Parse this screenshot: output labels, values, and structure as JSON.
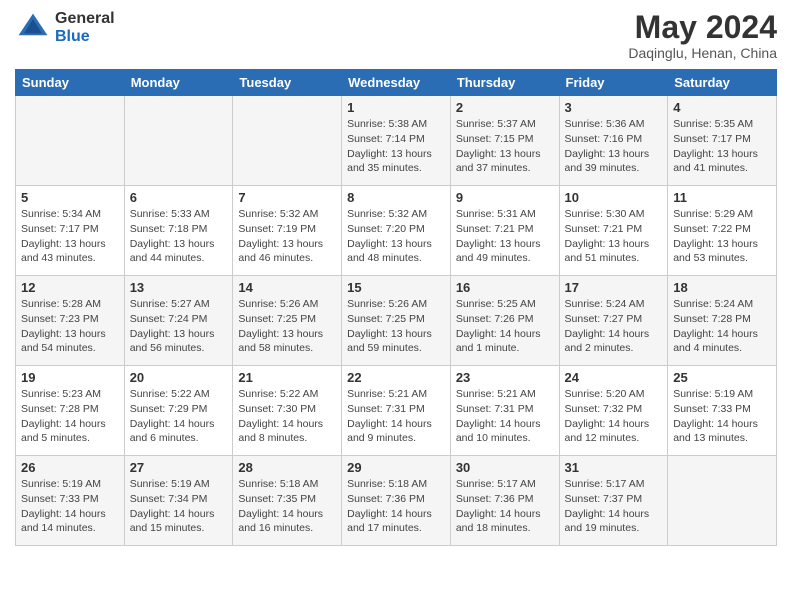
{
  "header": {
    "logo_general": "General",
    "logo_blue": "Blue",
    "month_year": "May 2024",
    "location": "Daqinglu, Henan, China"
  },
  "weekdays": [
    "Sunday",
    "Monday",
    "Tuesday",
    "Wednesday",
    "Thursday",
    "Friday",
    "Saturday"
  ],
  "weeks": [
    [
      {
        "day": "",
        "info": ""
      },
      {
        "day": "",
        "info": ""
      },
      {
        "day": "",
        "info": ""
      },
      {
        "day": "1",
        "info": "Sunrise: 5:38 AM\nSunset: 7:14 PM\nDaylight: 13 hours\nand 35 minutes."
      },
      {
        "day": "2",
        "info": "Sunrise: 5:37 AM\nSunset: 7:15 PM\nDaylight: 13 hours\nand 37 minutes."
      },
      {
        "day": "3",
        "info": "Sunrise: 5:36 AM\nSunset: 7:16 PM\nDaylight: 13 hours\nand 39 minutes."
      },
      {
        "day": "4",
        "info": "Sunrise: 5:35 AM\nSunset: 7:17 PM\nDaylight: 13 hours\nand 41 minutes."
      }
    ],
    [
      {
        "day": "5",
        "info": "Sunrise: 5:34 AM\nSunset: 7:17 PM\nDaylight: 13 hours\nand 43 minutes."
      },
      {
        "day": "6",
        "info": "Sunrise: 5:33 AM\nSunset: 7:18 PM\nDaylight: 13 hours\nand 44 minutes."
      },
      {
        "day": "7",
        "info": "Sunrise: 5:32 AM\nSunset: 7:19 PM\nDaylight: 13 hours\nand 46 minutes."
      },
      {
        "day": "8",
        "info": "Sunrise: 5:32 AM\nSunset: 7:20 PM\nDaylight: 13 hours\nand 48 minutes."
      },
      {
        "day": "9",
        "info": "Sunrise: 5:31 AM\nSunset: 7:21 PM\nDaylight: 13 hours\nand 49 minutes."
      },
      {
        "day": "10",
        "info": "Sunrise: 5:30 AM\nSunset: 7:21 PM\nDaylight: 13 hours\nand 51 minutes."
      },
      {
        "day": "11",
        "info": "Sunrise: 5:29 AM\nSunset: 7:22 PM\nDaylight: 13 hours\nand 53 minutes."
      }
    ],
    [
      {
        "day": "12",
        "info": "Sunrise: 5:28 AM\nSunset: 7:23 PM\nDaylight: 13 hours\nand 54 minutes."
      },
      {
        "day": "13",
        "info": "Sunrise: 5:27 AM\nSunset: 7:24 PM\nDaylight: 13 hours\nand 56 minutes."
      },
      {
        "day": "14",
        "info": "Sunrise: 5:26 AM\nSunset: 7:25 PM\nDaylight: 13 hours\nand 58 minutes."
      },
      {
        "day": "15",
        "info": "Sunrise: 5:26 AM\nSunset: 7:25 PM\nDaylight: 13 hours\nand 59 minutes."
      },
      {
        "day": "16",
        "info": "Sunrise: 5:25 AM\nSunset: 7:26 PM\nDaylight: 14 hours\nand 1 minute."
      },
      {
        "day": "17",
        "info": "Sunrise: 5:24 AM\nSunset: 7:27 PM\nDaylight: 14 hours\nand 2 minutes."
      },
      {
        "day": "18",
        "info": "Sunrise: 5:24 AM\nSunset: 7:28 PM\nDaylight: 14 hours\nand 4 minutes."
      }
    ],
    [
      {
        "day": "19",
        "info": "Sunrise: 5:23 AM\nSunset: 7:28 PM\nDaylight: 14 hours\nand 5 minutes."
      },
      {
        "day": "20",
        "info": "Sunrise: 5:22 AM\nSunset: 7:29 PM\nDaylight: 14 hours\nand 6 minutes."
      },
      {
        "day": "21",
        "info": "Sunrise: 5:22 AM\nSunset: 7:30 PM\nDaylight: 14 hours\nand 8 minutes."
      },
      {
        "day": "22",
        "info": "Sunrise: 5:21 AM\nSunset: 7:31 PM\nDaylight: 14 hours\nand 9 minutes."
      },
      {
        "day": "23",
        "info": "Sunrise: 5:21 AM\nSunset: 7:31 PM\nDaylight: 14 hours\nand 10 minutes."
      },
      {
        "day": "24",
        "info": "Sunrise: 5:20 AM\nSunset: 7:32 PM\nDaylight: 14 hours\nand 12 minutes."
      },
      {
        "day": "25",
        "info": "Sunrise: 5:19 AM\nSunset: 7:33 PM\nDaylight: 14 hours\nand 13 minutes."
      }
    ],
    [
      {
        "day": "26",
        "info": "Sunrise: 5:19 AM\nSunset: 7:33 PM\nDaylight: 14 hours\nand 14 minutes."
      },
      {
        "day": "27",
        "info": "Sunrise: 5:19 AM\nSunset: 7:34 PM\nDaylight: 14 hours\nand 15 minutes."
      },
      {
        "day": "28",
        "info": "Sunrise: 5:18 AM\nSunset: 7:35 PM\nDaylight: 14 hours\nand 16 minutes."
      },
      {
        "day": "29",
        "info": "Sunrise: 5:18 AM\nSunset: 7:36 PM\nDaylight: 14 hours\nand 17 minutes."
      },
      {
        "day": "30",
        "info": "Sunrise: 5:17 AM\nSunset: 7:36 PM\nDaylight: 14 hours\nand 18 minutes."
      },
      {
        "day": "31",
        "info": "Sunrise: 5:17 AM\nSunset: 7:37 PM\nDaylight: 14 hours\nand 19 minutes."
      },
      {
        "day": "",
        "info": ""
      }
    ]
  ]
}
